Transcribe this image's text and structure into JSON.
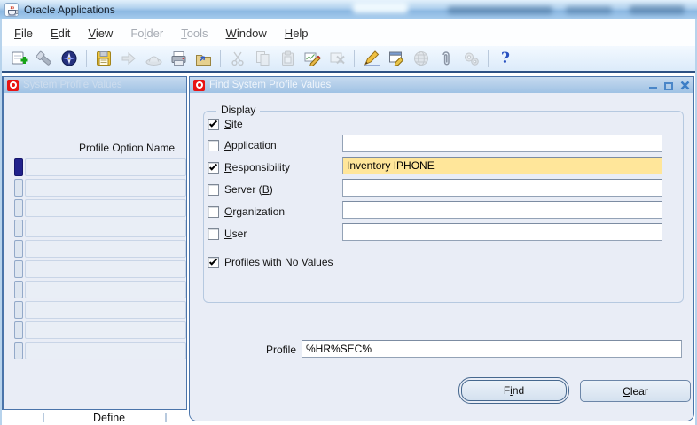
{
  "os_window": {
    "title": "Oracle Applications"
  },
  "menu": [
    {
      "text": "File",
      "u": 0,
      "enabled": true
    },
    {
      "text": "Edit",
      "u": 0,
      "enabled": true
    },
    {
      "text": "View",
      "u": 0,
      "enabled": true
    },
    {
      "text": "Folder",
      "u": 2,
      "enabled": false
    },
    {
      "text": "Tools",
      "u": 0,
      "enabled": false
    },
    {
      "text": "Window",
      "u": 0,
      "enabled": true
    },
    {
      "text": "Help",
      "u": 0,
      "enabled": true
    }
  ],
  "toolbar": {
    "groups": [
      [
        "new-record",
        "find",
        "show-navigator"
      ],
      [
        "save",
        "next-step",
        "switch-responsibility",
        "print",
        "close-form"
      ],
      [
        "cut",
        "copy",
        "paste",
        "clear-record",
        "delete-record"
      ],
      [
        "edit-field",
        "zoom",
        "translations",
        "attachments",
        "folder-tools"
      ],
      [
        "help"
      ]
    ],
    "disabled": [
      "next-step",
      "switch-responsibility",
      "cut",
      "copy",
      "paste",
      "delete-record",
      "translations",
      "folder-tools"
    ]
  },
  "windows": {
    "profile_values": {
      "title": "System Profile Values",
      "column_header": "Profile Option Name",
      "visible_rows": 10,
      "active_row": 1
    },
    "find": {
      "title": "Find System Profile Values",
      "controls": [
        "minimize",
        "maximize",
        "close"
      ],
      "display_group": {
        "label": "Display",
        "items": [
          {
            "label": {
              "text": "Site",
              "u": 0
            },
            "checked": true,
            "field": false
          },
          {
            "label": {
              "text": "Application",
              "u": 0
            },
            "checked": false,
            "field": true,
            "value": ""
          },
          {
            "label": {
              "text": "Responsibility",
              "u": 0
            },
            "checked": true,
            "field": true,
            "value": "Inventory IPHONE",
            "highlighted": true
          },
          {
            "label": {
              "text": "Server (B)",
              "u": 8
            },
            "checked": false,
            "field": true,
            "value": ""
          },
          {
            "label": {
              "text": "Organization",
              "u": 0
            },
            "checked": false,
            "field": true,
            "value": ""
          },
          {
            "label": {
              "text": "User",
              "u": 0
            },
            "checked": false,
            "field": true,
            "value": ""
          }
        ],
        "no_values": {
          "label": {
            "text": "Profiles with No Values",
            "u": 0
          },
          "checked": true
        }
      },
      "profile": {
        "label": "Profile",
        "value": "%HR%SEC%"
      },
      "buttons": {
        "find": {
          "text": "Find",
          "u": 1,
          "default": true
        },
        "clear": {
          "text": "Clear",
          "u": 0,
          "default": false
        }
      }
    }
  },
  "background": {
    "define_label": "Define"
  },
  "colors": {
    "os_titlebar_blue": "#8cb8e2",
    "window_title_blue": "#9fc2e4",
    "client_bg": "#e9edf6",
    "highlight_yellow": "#ffe69a",
    "oracle_red": "#e81313",
    "window_border_blue": "#4a74aa",
    "toolbar_divider_navy": "#2d5183",
    "active_record_navy": "#22228c"
  }
}
